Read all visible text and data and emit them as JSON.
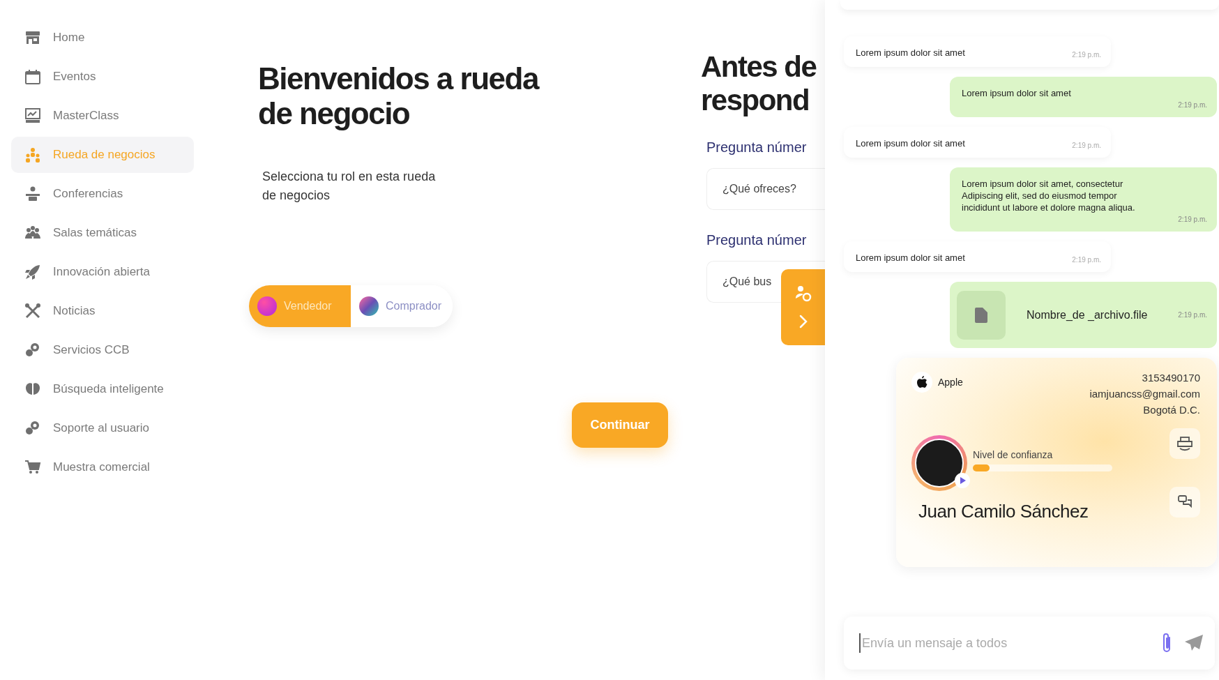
{
  "sidebar": {
    "items": [
      {
        "label": "Home",
        "selected": false
      },
      {
        "label": "Eventos",
        "selected": false
      },
      {
        "label": "MasterClass",
        "selected": false
      },
      {
        "label": "Rueda de negocios",
        "selected": true
      },
      {
        "label": "Conferencias",
        "selected": false
      },
      {
        "label": "Salas temáticas",
        "selected": false
      },
      {
        "label": "Innovación abierta",
        "selected": false
      },
      {
        "label": "Noticias",
        "selected": false
      },
      {
        "label": "Servicios CCB",
        "selected": false
      },
      {
        "label": "Búsqueda inteligente",
        "selected": false
      },
      {
        "label": "Soporte al usuario",
        "selected": false
      },
      {
        "label": "Muestra comercial",
        "selected": false
      }
    ]
  },
  "welcome": {
    "title": "Bienvenidos a rueda de negocio",
    "subtitle": "Selecciona tu rol en esta rueda de negocios",
    "roles": [
      {
        "label": "Vendedor",
        "selected": true
      },
      {
        "label": "Comprador",
        "selected": false
      }
    ],
    "continue_button": "Continuar"
  },
  "questions": {
    "title_lines": [
      "Antes de",
      "respond"
    ],
    "items": [
      {
        "label": "Pregunta númer",
        "placeholder": "¿Qué ofreces?"
      },
      {
        "label": "Pregunta númer",
        "placeholder": "¿Qué bus"
      }
    ]
  },
  "chat": {
    "messages": [
      {
        "kind": "text",
        "outgoing": false,
        "text": "Lorem ipsum dolor sit amet",
        "time": "2:19 p.m."
      },
      {
        "kind": "text",
        "outgoing": true,
        "text": "Lorem ipsum dolor sit amet",
        "time": "2:19 p.m."
      },
      {
        "kind": "text",
        "outgoing": false,
        "text": "Lorem ipsum dolor sit amet",
        "time": "2:19 p.m."
      },
      {
        "kind": "text",
        "outgoing": true,
        "text": "Lorem ipsum dolor sit amet, consectetur Adipiscing elit, sed do eiusmod tempor incididunt ut labore et dolore magna aliqua.",
        "time": "2:19 p.m."
      },
      {
        "kind": "text",
        "outgoing": false,
        "text": "Lorem ipsum dolor sit amet",
        "time": "2:19 p.m."
      },
      {
        "kind": "file",
        "outgoing": true,
        "text": "Nombre_de _archivo.file",
        "time": "2:19 p.m."
      }
    ],
    "contact_card": {
      "company": "Apple",
      "phone": "3153490170",
      "email": "iamjuancss@gmail.com",
      "city": "Bogotá D.C.",
      "trust_label": "Nivel de confianza",
      "level": 0.12,
      "name": "Juan Camilo Sánchez"
    },
    "composer": {
      "placeholder": "Envía un mensaje a todos"
    }
  }
}
